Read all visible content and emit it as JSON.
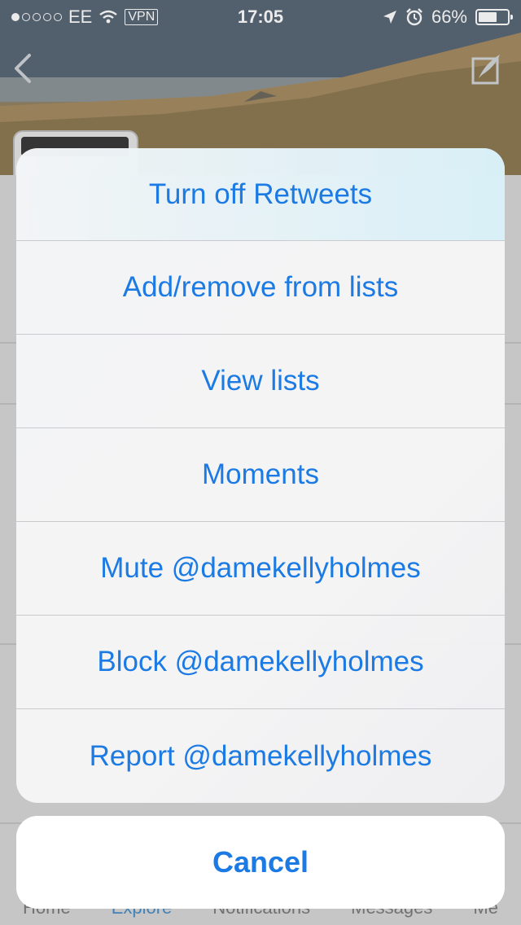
{
  "status_bar": {
    "carrier": "EE",
    "vpn": "VPN",
    "time": "17:05",
    "battery": "66%",
    "battery_level": 0.66,
    "signal_dots_filled": 1,
    "icons": [
      "wifi-icon",
      "location-arrow-icon",
      "alarm-icon",
      "battery-icon"
    ]
  },
  "nav": {
    "back_icon": "chevron-left-icon",
    "compose_icon": "compose-quill-icon"
  },
  "bottom_tabs": {
    "items": [
      {
        "label": "Home"
      },
      {
        "label": "Explore"
      },
      {
        "label": "Notifications"
      },
      {
        "label": "Messages"
      },
      {
        "label": "Me"
      }
    ],
    "active": "Explore"
  },
  "action_sheet": {
    "items": [
      {
        "label": "Turn off Retweets"
      },
      {
        "label": "Add/remove from lists"
      },
      {
        "label": "View lists"
      },
      {
        "label": "Moments"
      },
      {
        "label": "Mute @damekellyholmes"
      },
      {
        "label": "Block @damekellyholmes"
      },
      {
        "label": "Report @damekellyholmes"
      }
    ],
    "cancel_label": "Cancel"
  },
  "colors": {
    "action_text": "#1b7ae3",
    "sheet_background": "#f5f6f7"
  }
}
